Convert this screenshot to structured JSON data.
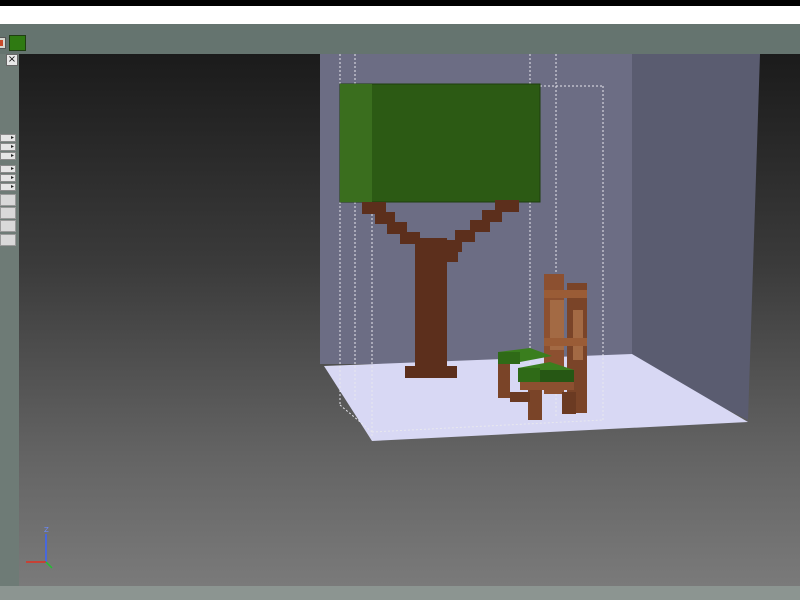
{
  "app": {
    "close_glyph": "×",
    "side_arrow_glyph": "▸",
    "active_color": "#2f7a12"
  },
  "viewport": {
    "gradient_top": "#1b1b1b",
    "gradient_bottom": "#7a7a7a"
  },
  "scene": {
    "objects": [
      "tree",
      "chair",
      "room"
    ],
    "tree_leaf_color": "#2c5a14",
    "trunk_color": "#5c2f1c",
    "chair_wood_color": "#8c5030",
    "chair_seat_color": "#2f6a17",
    "floor_color": "#d8d8f4",
    "back_wall_color": "#6c6d84",
    "side_wall_color": "#5a5c70"
  },
  "axis": {
    "z_label": "Z",
    "icons": [
      "z-axis-icon",
      "x-axis-icon",
      "y-axis-icon"
    ]
  }
}
